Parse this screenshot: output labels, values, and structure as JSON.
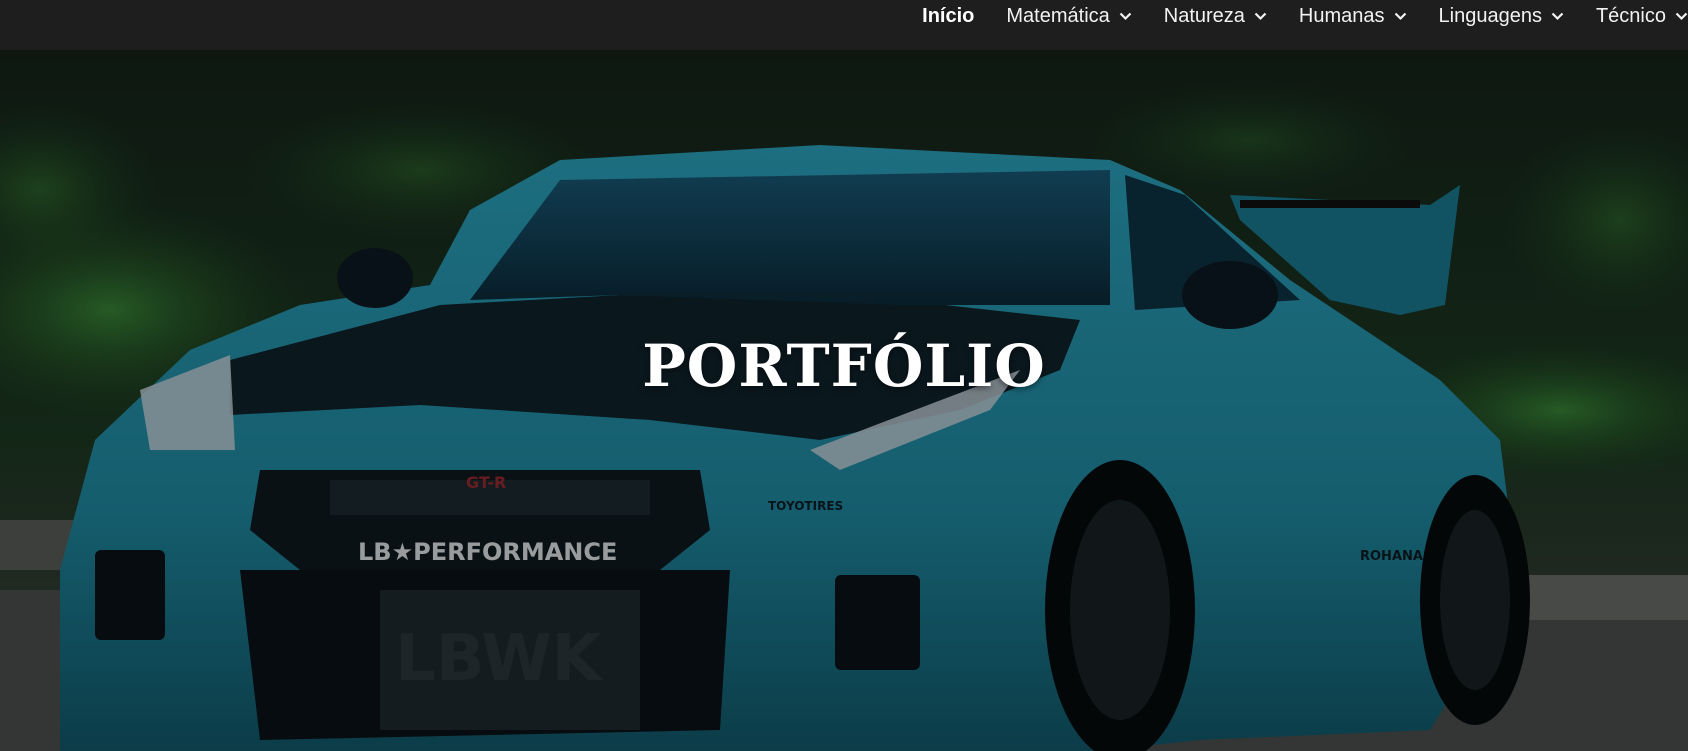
{
  "nav": {
    "items": [
      {
        "label": "Início",
        "active": true,
        "dropdown": false,
        "icon": ""
      },
      {
        "label": "Matemática",
        "active": false,
        "dropdown": true,
        "icon": "chevron-down-icon"
      },
      {
        "label": "Natureza",
        "active": false,
        "dropdown": true,
        "icon": "chevron-down-icon"
      },
      {
        "label": "Humanas",
        "active": false,
        "dropdown": true,
        "icon": "chevron-down-icon"
      },
      {
        "label": "Linguagens",
        "active": false,
        "dropdown": true,
        "icon": "chevron-down-icon"
      },
      {
        "label": "Técnico",
        "active": false,
        "dropdown": true,
        "icon": "chevron-down-icon"
      }
    ]
  },
  "hero": {
    "title": "PORTFÓLIO",
    "image_logo_text": [
      "LB★PERFORMANCE",
      "LBWK",
      "TOYOTIRES",
      "GT-R",
      "ROHANA"
    ]
  },
  "colors": {
    "navbar_bg": "#1e1e1e",
    "car_body": "#1f8fa8",
    "foliage": "#1f5a22"
  }
}
